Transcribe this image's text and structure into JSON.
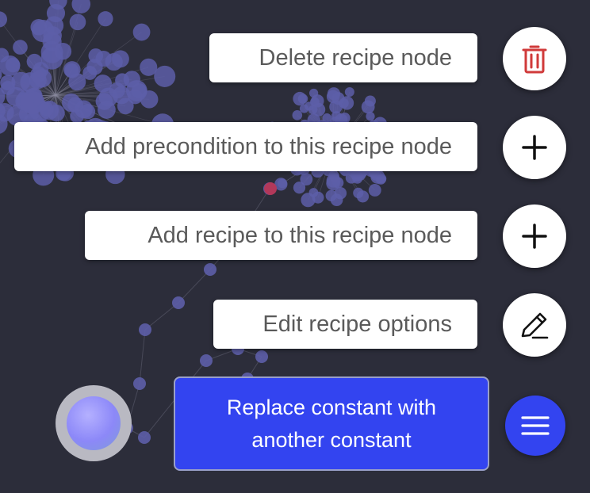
{
  "actions": {
    "delete_label": "Delete recipe node",
    "add_precondition_label": "Add precondition to this recipe node",
    "add_recipe_label": "Add recipe to this recipe node",
    "edit_options_label": "Edit recipe options"
  },
  "tooltip": {
    "line1": "Replace constant with",
    "line2": "another constant"
  },
  "icons": {
    "delete": "trash-icon",
    "add_precondition": "plus-icon",
    "add_recipe": "plus-icon",
    "edit": "pencil-icon",
    "menu": "menu-icon"
  },
  "colors": {
    "background": "#2c2d3a",
    "accent": "#3344f0",
    "danger": "#d03a3a",
    "node": "#5d5ea8",
    "highlight_node": "#b2385a"
  }
}
